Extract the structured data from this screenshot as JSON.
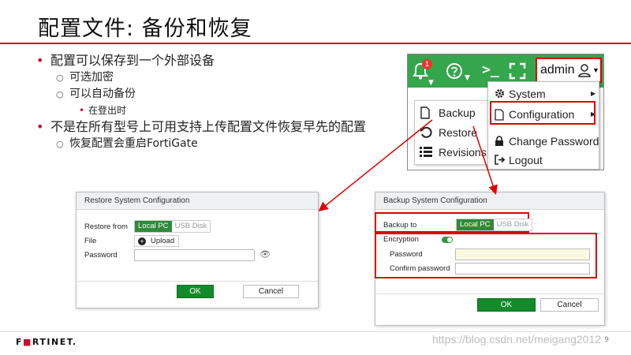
{
  "slide": {
    "title": "配置文件: 备份和恢复",
    "bullets": [
      {
        "text": "配置可以保存到一个外部设备",
        "sub": [
          {
            "text": "可选加密"
          },
          {
            "text": "可以自动备份",
            "sub": [
              "在登出时"
            ]
          }
        ]
      },
      {
        "text": "不是在所有型号上可用支持上传配置文件恢复早先的配置",
        "sub": [
          {
            "text": "恢复配置会重启FortiGate"
          }
        ]
      }
    ],
    "footer": {
      "logo_prefix": "F",
      "logo_accent": "",
      "logo_rest": "RTINET.",
      "page_number": "9"
    },
    "watermark": "https://blog.csdn.net/meigang2012"
  },
  "fortigate": {
    "notification_count": "1",
    "terminal_symbol": ">_",
    "user_button_label": "admin",
    "user_menu": [
      {
        "label": "System",
        "icon": "gear-icon",
        "has_submenu": true
      },
      {
        "label": "Configuration",
        "icon": "file-icon",
        "has_submenu": true
      },
      {
        "label": "Change Password",
        "icon": "lock-icon",
        "has_submenu": false
      },
      {
        "label": "Logout",
        "icon": "logout-icon",
        "has_submenu": false
      }
    ],
    "config_submenu": [
      {
        "label": "Backup",
        "icon": "file-icon"
      },
      {
        "label": "Restore",
        "icon": "restore-icon"
      },
      {
        "label": "Revisions",
        "icon": "list-icon"
      }
    ]
  },
  "restore_dialog": {
    "title": "Restore System Configuration",
    "restore_from_label": "Restore from",
    "source_options": [
      "Local PC",
      "USB Disk"
    ],
    "selected_source": "Local PC",
    "file_label": "File",
    "upload_label": "Upload",
    "password_label": "Password",
    "password_value": "",
    "ok_label": "OK",
    "cancel_label": "Cancel"
  },
  "backup_dialog": {
    "title": "Backup System Configuration",
    "backup_to_label": "Backup to",
    "target_options": [
      "Local PC",
      "USB Disk"
    ],
    "selected_target": "Local PC",
    "encryption_label": "Encryption",
    "encryption_enabled": true,
    "password_label": "Password",
    "password_value": "",
    "confirm_password_label": "Confirm password",
    "confirm_password_value": "",
    "ok_label": "OK",
    "cancel_label": "Cancel"
  },
  "colors": {
    "accent_red": "#c8102e",
    "fortigate_green": "#34a64b",
    "ok_green": "#148a2a",
    "highlight_red": "#dd0000"
  }
}
